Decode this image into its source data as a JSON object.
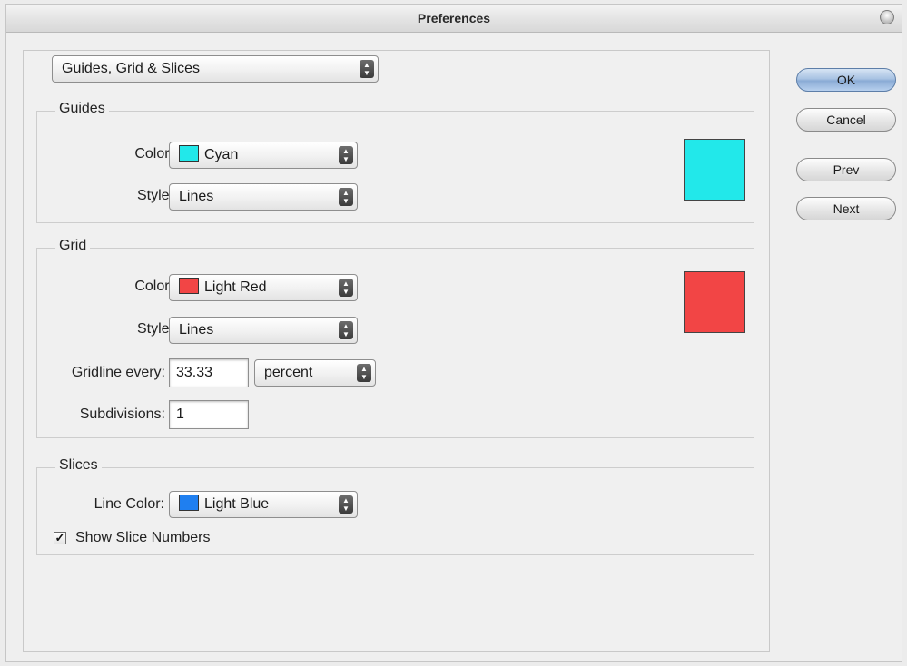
{
  "window": {
    "title": "Preferences"
  },
  "section_select": {
    "value": "Guides, Grid & Slices"
  },
  "guides": {
    "title": "Guides",
    "color_label": "Color:",
    "color_value": "Cyan",
    "color_hex": "#22e8ea",
    "style_label": "Style:",
    "style_value": "Lines"
  },
  "grid": {
    "title": "Grid",
    "color_label": "Color:",
    "color_value": "Light Red",
    "color_hex": "#f24545",
    "style_label": "Style:",
    "style_value": "Lines",
    "gridline_label": "Gridline every:",
    "gridline_value": "33.33",
    "gridline_unit": "percent",
    "subdivisions_label": "Subdivisions:",
    "subdivisions_value": "1"
  },
  "slices": {
    "title": "Slices",
    "line_color_label": "Line Color:",
    "line_color_value": "Light Blue",
    "line_color_hex": "#1f7ff0",
    "show_numbers_label": "Show Slice Numbers",
    "show_numbers_checked": true
  },
  "buttons": {
    "ok": "OK",
    "cancel": "Cancel",
    "prev": "Prev",
    "next": "Next"
  }
}
